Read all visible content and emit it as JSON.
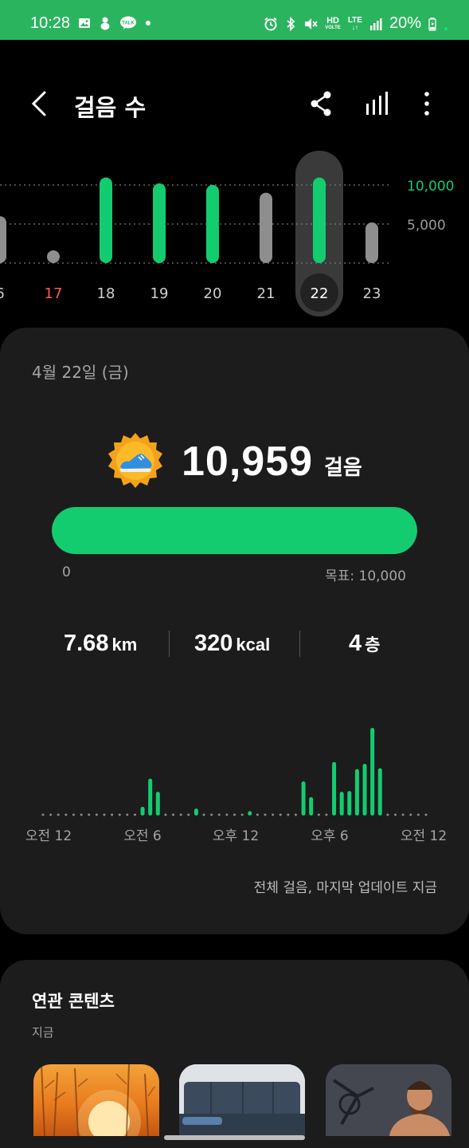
{
  "status_bar": {
    "time": "10:28",
    "battery_text": "20%",
    "network": "LTE",
    "hd_label": "HD"
  },
  "header": {
    "title": "걸음 수"
  },
  "weekly_chart": {
    "days": [
      "6",
      "17",
      "18",
      "19",
      "20",
      "21",
      "22",
      "23"
    ],
    "steps": [
      6000,
      0,
      10959,
      10200,
      10000,
      9000,
      10959,
      5200
    ],
    "met_goal": [
      false,
      false,
      true,
      true,
      true,
      false,
      true,
      false
    ],
    "highlight_index": 1,
    "selected_index": 6,
    "ref_labels": [
      "10,000",
      "5,000"
    ],
    "ref_values": [
      10000,
      5000
    ]
  },
  "summary": {
    "date": "4월 22일 (금)",
    "steps": "10,959",
    "steps_unit": "걸음",
    "progress_fraction": 1.0,
    "progress_min": "0",
    "goal_label": "목표: 10,000",
    "distance_value": "7.68",
    "distance_unit": "km",
    "calories_value": "320",
    "calories_unit": "kcal",
    "floors_value": "4",
    "floors_unit": "층",
    "update_note": "전체 걸음, 마지막 업데이트 지금"
  },
  "chart_data": {
    "type": "bar",
    "title": "",
    "xlabel": "",
    "ylabel": "",
    "x_tick_labels": [
      "오전 12",
      "오전 6",
      "오후 12",
      "오후 6",
      "오전 12"
    ],
    "values": [
      0.03,
      0,
      0,
      0,
      0,
      0,
      0,
      0,
      0,
      0,
      0,
      0,
      0,
      0.1,
      0.42,
      0.27,
      0,
      0,
      0,
      0,
      0.08,
      0,
      0,
      0,
      0,
      0,
      0,
      0.05,
      0,
      0,
      0,
      0,
      0,
      0,
      0.39,
      0.21,
      0,
      0,
      0.61,
      0.27,
      0.28,
      0.53,
      0.59,
      1.0,
      0.54,
      0,
      0,
      0,
      0,
      0,
      0
    ],
    "color": "#14cc70"
  },
  "related": {
    "title": "연관 콘텐츠",
    "subtitle": "지금"
  },
  "colors": {
    "accent": "#14cc70",
    "status_bar": "#2bb45e",
    "inactive_bar": "#8e8e8e",
    "highlight_day": "#ff5a5a"
  }
}
